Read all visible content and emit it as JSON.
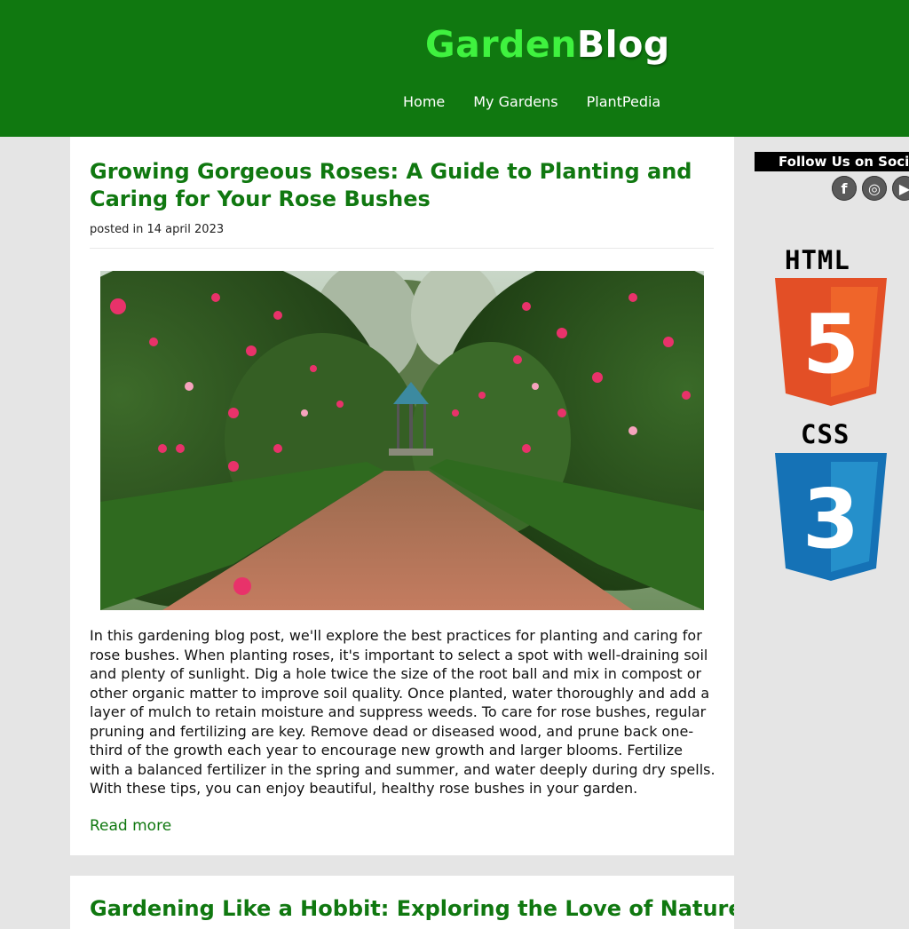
{
  "header": {
    "logo_part1": "Garden",
    "logo_part2": "Blog",
    "nav": [
      {
        "label": "Home"
      },
      {
        "label": "My Gardens"
      },
      {
        "label": "PlantPedia"
      }
    ],
    "background_color": "#107810",
    "accent_color": "#3ff23f"
  },
  "post": {
    "title": "Growing Gorgeous Roses: A Guide to Planting and Caring for Your Rose Bushes",
    "date": "posted in 14 april 2023",
    "image_alt": "Garden path lined with rose bushes",
    "body": "In this gardening blog post, we'll explore the best practices for planting and caring for rose bushes. When planting roses, it's important to select a spot with well-draining soil and plenty of sunlight. Dig a hole twice the size of the root ball and mix in compost or other organic matter to improve soil quality. Once planted, water thoroughly and add a layer of mulch to retain moisture and suppress weeds. To care for rose bushes, regular pruning and fertilizing are key. Remove dead or diseased wood, and prune back one-third of the growth each year to encourage new growth and larger blooms. Fertilize with a balanced fertilizer in the spring and summer, and water deeply during dry spells. With these tips, you can enjoy beautiful, healthy rose bushes in your garden.",
    "read_more": "Read more"
  },
  "next_post": {
    "title": "Gardening Like a Hobbit: Exploring the Love of Nature"
  },
  "sidebar": {
    "follow_label": "Follow Us on Soci",
    "social": [
      {
        "icon": "facebook-icon",
        "glyph": "f"
      },
      {
        "icon": "instagram-icon",
        "glyph": "◎"
      },
      {
        "icon": "youtube-icon",
        "glyph": "▶"
      }
    ],
    "html_label": "HTML",
    "html_badge_number": "5",
    "css_label": "CSS",
    "css_badge_number": "3",
    "html_color": "#e34f26",
    "css_color": "#1572b6"
  }
}
